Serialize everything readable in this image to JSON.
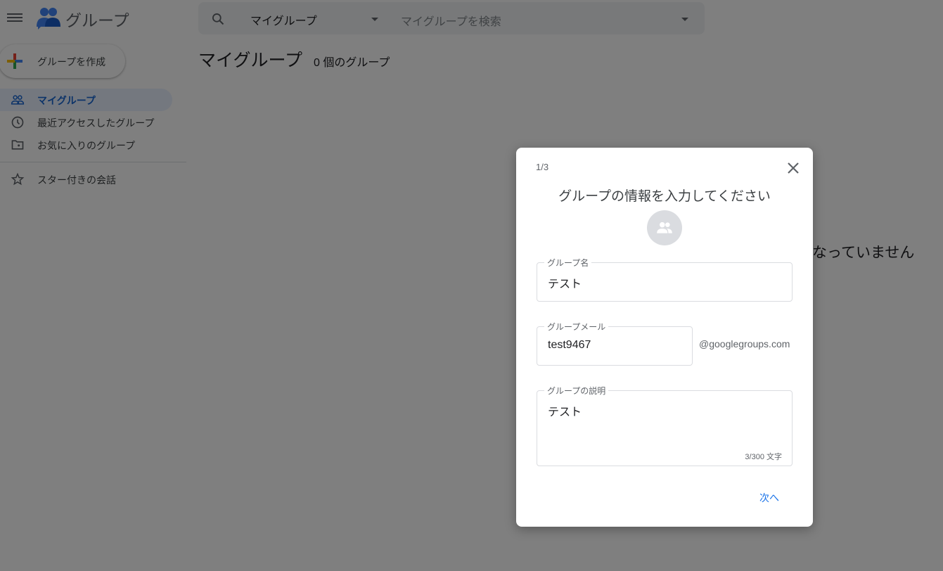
{
  "app": {
    "title": "グループ"
  },
  "search": {
    "scope": "マイグループ",
    "placeholder": "マイグループを検索"
  },
  "sidebar": {
    "create_label": "グループを作成",
    "items": [
      {
        "label": "マイグループ",
        "icon": "people-icon",
        "active": true
      },
      {
        "label": "最近アクセスしたグループ",
        "icon": "clock-icon"
      },
      {
        "label": "お気に入りのグループ",
        "icon": "folder-star-icon"
      },
      {
        "label": "スター付きの会話",
        "icon": "star-icon"
      }
    ]
  },
  "main": {
    "title": "マイグループ",
    "count": "0 個のグループ",
    "empty_text": "なっていません"
  },
  "dialog": {
    "step": "1/3",
    "title": "グループの情報を入力してください",
    "name": {
      "label": "グループ名",
      "value": "テスト"
    },
    "email": {
      "label": "グループメール",
      "value": "test9467",
      "suffix": "@googlegroups.com"
    },
    "description": {
      "label": "グループの説明",
      "value": "テスト",
      "counter": "3/300 文字"
    },
    "next_label": "次へ"
  },
  "colors": {
    "accent": "#1a73e8",
    "active_bg": "#e8f0fe"
  }
}
